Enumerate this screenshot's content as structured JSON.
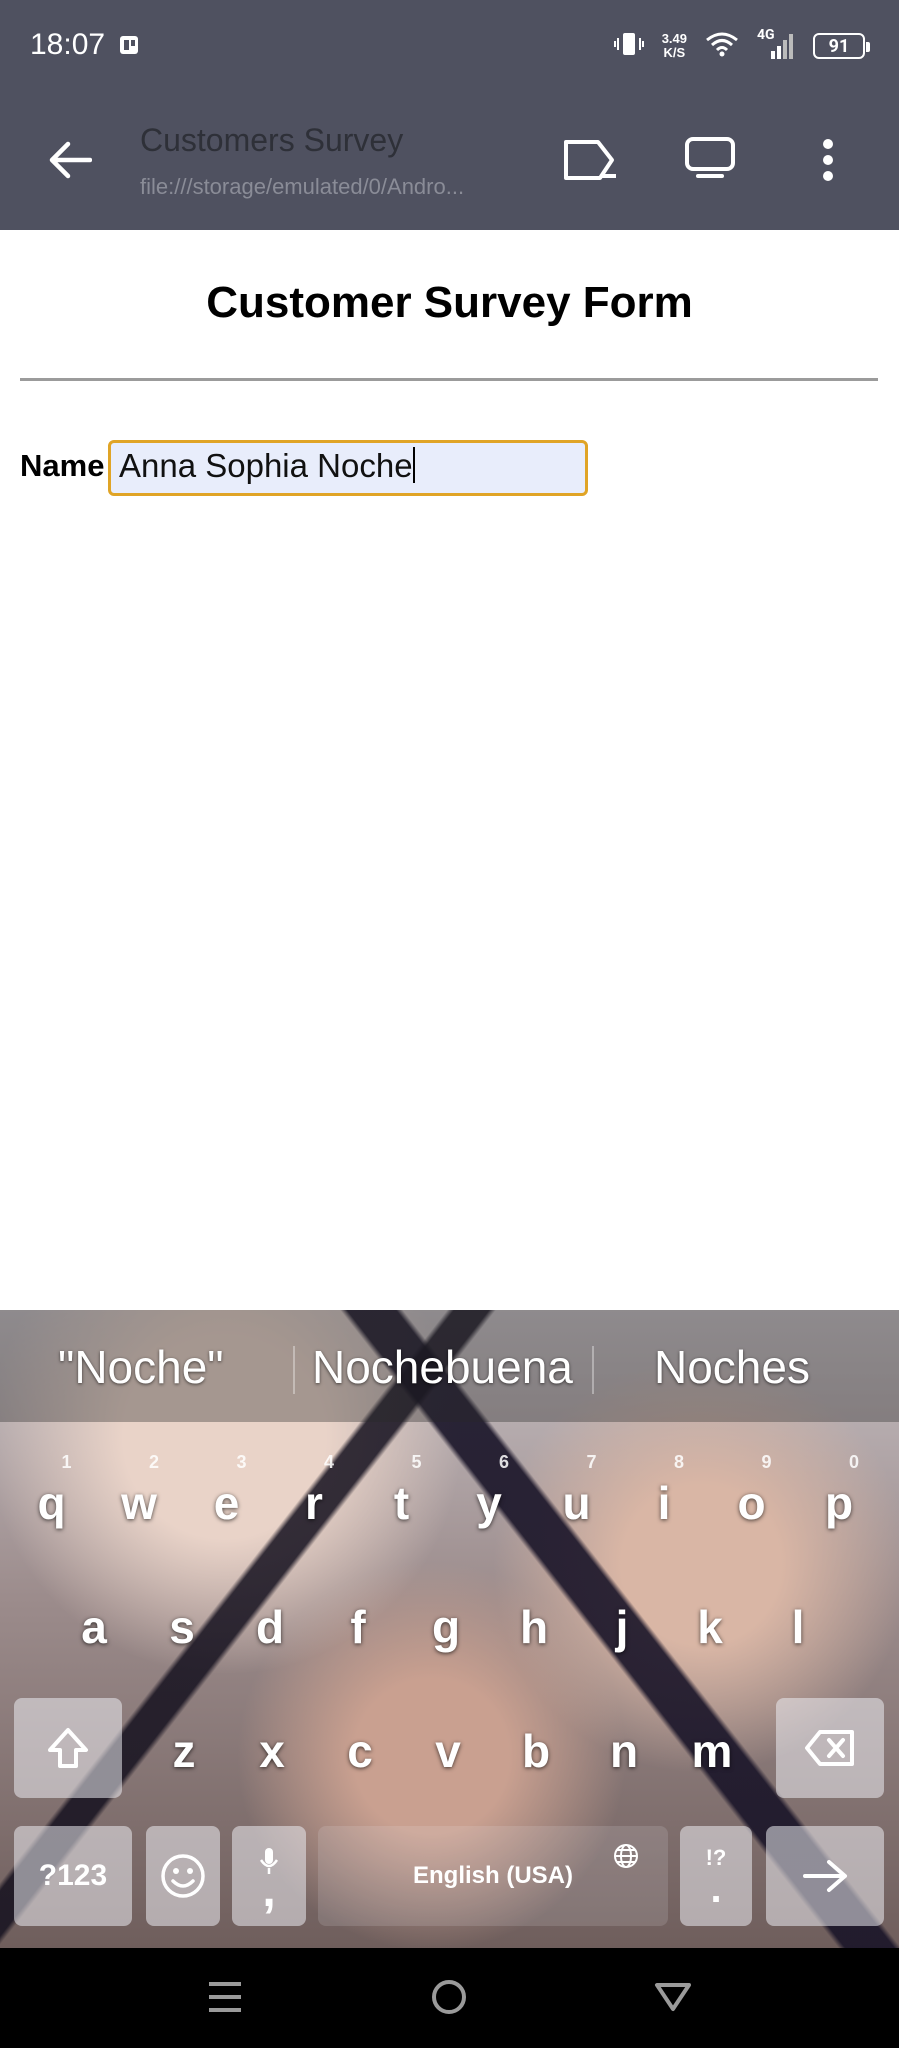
{
  "status_bar": {
    "time": "18:07",
    "network_speed_value": "3.49",
    "network_speed_unit": "K/S",
    "network_type": "4G",
    "battery": "91"
  },
  "app_bar": {
    "title": "Customers Survey",
    "url": "file:///storage/emulated/0/Andro..."
  },
  "page": {
    "form_title": "Customer Survey Form",
    "name_label": "Name",
    "name_value": "Anna Sophia Noche"
  },
  "keyboard": {
    "suggestions": [
      "\"Noche\"",
      "Nochebuena",
      "Noches"
    ],
    "row1": [
      "q",
      "w",
      "e",
      "r",
      "t",
      "y",
      "u",
      "i",
      "o",
      "p"
    ],
    "row1_hints": [
      "1",
      "2",
      "3",
      "4",
      "5",
      "6",
      "7",
      "8",
      "9",
      "0"
    ],
    "row2": [
      "a",
      "s",
      "d",
      "f",
      "g",
      "h",
      "j",
      "k",
      "l"
    ],
    "row3": [
      "z",
      "x",
      "c",
      "v",
      "b",
      "n",
      "m"
    ],
    "symbols_label": "?123",
    "comma_label": ",",
    "space_label": "English (USA)",
    "period_label": ".",
    "punct_hint": "!?"
  }
}
